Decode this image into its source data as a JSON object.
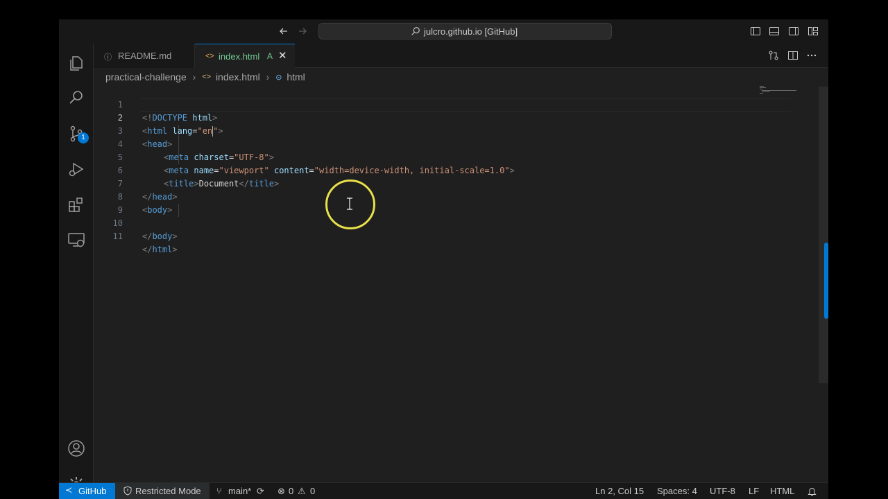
{
  "titlebar": {
    "command_center_text": "julcro.github.io [GitHub]"
  },
  "activity_bar": {
    "items": [
      "explorer-icon",
      "search-icon",
      "source-control-icon",
      "run-debug-icon",
      "extensions-icon",
      "remote-explorer-icon"
    ],
    "scm_badge": "1"
  },
  "tabs": [
    {
      "label": "README.md",
      "icon": "info-icon"
    },
    {
      "label": "index.html",
      "icon": "code-icon",
      "status": "A",
      "active": true
    }
  ],
  "breadcrumb": {
    "items": [
      "practical-challenge",
      "index.html",
      "html"
    ]
  },
  "editor": {
    "line_numbers": [
      "1",
      "2",
      "3",
      "4",
      "5",
      "6",
      "7",
      "8",
      "9",
      "10",
      "11"
    ],
    "lines": [
      {
        "t1": "<!",
        "t2": "DOCTYPE",
        "t3": " html",
        "t4": ">"
      },
      {
        "open": "<",
        "tag": "html",
        "attr": " lang",
        "eq": "=",
        "str_before": "\"en",
        "str_after": "\"",
        "close": ">"
      },
      {
        "open": "<",
        "tag": "head",
        "close": ">"
      },
      {
        "open": "<",
        "tag": "meta",
        "attr": " charset",
        "eq": "=",
        "str": "\"UTF-8\"",
        "close": ">"
      },
      {
        "open": "<",
        "tag": "meta",
        "attr1": " name",
        "eq1": "=",
        "str1": "\"viewport\"",
        "attr2": " content",
        "eq2": "=",
        "str2": "\"width=device-width, initial-scale=1.0\"",
        "close": ">"
      },
      {
        "open": "<",
        "tag": "title",
        "close": ">",
        "text": "Document",
        "open2": "</",
        "tag2": "title",
        "close2": ">"
      },
      {
        "open": "</",
        "tag": "head",
        "close": ">"
      },
      {
        "open": "<",
        "tag": "body",
        "close": ">"
      },
      {},
      {
        "open": "</",
        "tag": "body",
        "close": ">"
      },
      {
        "open": "</",
        "tag": "html",
        "close": ">"
      }
    ]
  },
  "statusbar": {
    "remote": "GitHub",
    "restricted_mode": "Restricted Mode",
    "branch": "main*",
    "errors": "0",
    "warnings": "0",
    "cursor_position": "Ln 2, Col 15",
    "indentation": "Spaces: 4",
    "encoding": "UTF-8",
    "eol": "LF",
    "language": "HTML"
  },
  "colors": {
    "accent": "#0078d4",
    "modified_tab": "#73c991",
    "click_ring": "#e8e04a"
  }
}
